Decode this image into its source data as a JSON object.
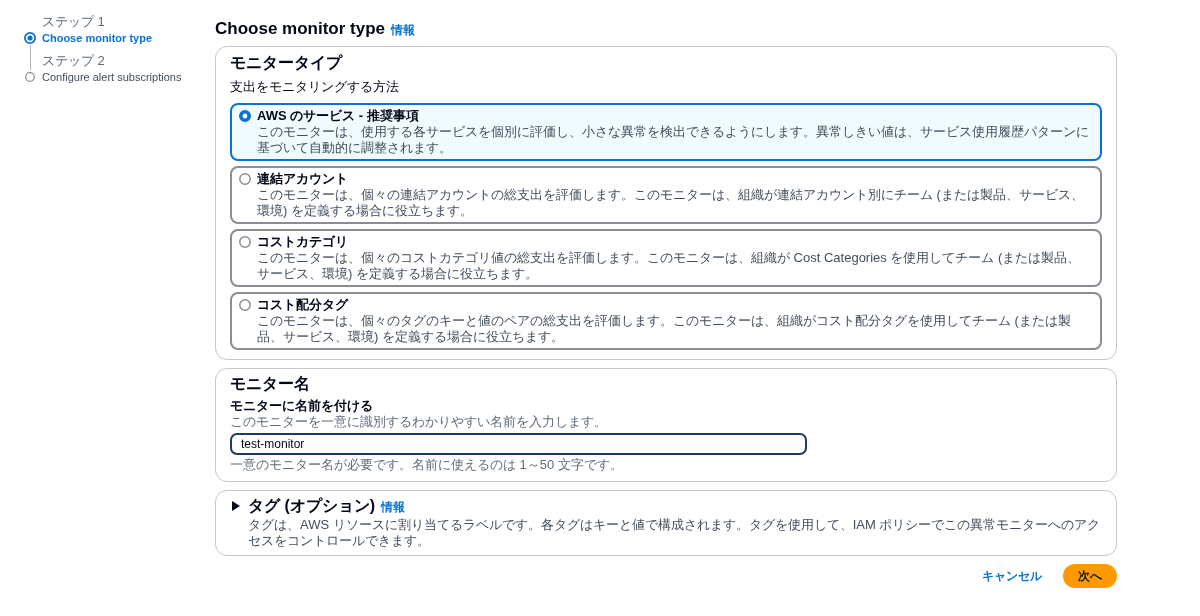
{
  "steps": [
    {
      "caption": "ステップ 1",
      "label": "Choose monitor type",
      "selected": true
    },
    {
      "caption": "ステップ 2",
      "label": "Configure alert subscriptions",
      "selected": false
    }
  ],
  "page": {
    "title": "Choose monitor type",
    "info_link": "情報"
  },
  "monitor_type": {
    "heading": "モニタータイプ",
    "question": "支出をモニタリングする方法",
    "options": [
      {
        "label": "AWS のサービス - 推奨事項",
        "description": "このモニターは、使用する各サービスを個別に評価し、小さな異常を検出できるようにします。異常しきい値は、サービス使用履歴パターンに基づいて自動的に調整されます。",
        "selected": true
      },
      {
        "label": "連結アカウント",
        "description": "このモニターは、個々の連結アカウントの総支出を評価します。このモニターは、組織が連結アカウント別にチーム (または製品、サービス、環境) を定義する場合に役立ちます。",
        "selected": false
      },
      {
        "label": "コストカテゴリ",
        "description": "このモニターは、個々のコストカテゴリ値の総支出を評価します。このモニターは、組織が Cost Categories を使用してチーム (または製品、サービス、環境) を定義する場合に役立ちます。",
        "selected": false
      },
      {
        "label": "コスト配分タグ",
        "description": "このモニターは、個々のタグのキーと値のペアの総支出を評価します。このモニターは、組織がコスト配分タグを使用してチーム (または製品、サービス、環境) を定義する場合に役立ちます。",
        "selected": false
      }
    ]
  },
  "monitor_name": {
    "heading": "モニター名",
    "label": "モニターに名前を付ける",
    "description": "このモニターを一意に識別するわかりやすい名前を入力します。",
    "value": "test-monitor",
    "constraint": "一意のモニター名が必要です。名前に使えるのは 1～50 文字です。"
  },
  "tags": {
    "heading": "タグ (オプション)",
    "info_link": "情報",
    "description": "タグは、AWS リソースに割り当てるラベルです。各タグはキーと値で構成されます。タグを使用して、IAM ポリシーでこの異常モニターへのアクセスをコントロールできます。",
    "expanded": false
  },
  "buttons": [
    {
      "label": "キャンセル",
      "kind": "link"
    },
    {
      "label": "次へ",
      "kind": "primary"
    }
  ]
}
